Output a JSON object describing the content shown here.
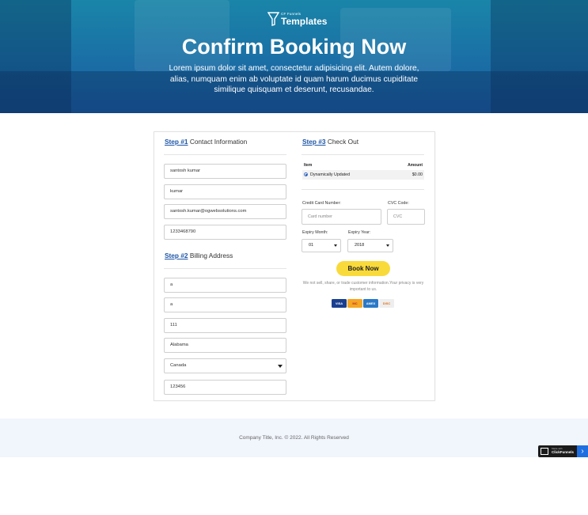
{
  "hero": {
    "logo_small": "CF Funnels",
    "logo_big": "Templates",
    "title": "Confirm Booking Now",
    "subtitle": "Lorem ipsum dolor sit amet, consectetur adipisicing elit. Autem dolore, alias, numquam enim ab voluptate id quam harum ducimus cupiditate similique quisquam et deserunt, recusandae."
  },
  "step1": {
    "link": "Step #1",
    "title": "Contact Information"
  },
  "contact_fields": [
    "santosh kumar",
    "kumar",
    "santosh.kumar@ogwebsolutions.com",
    "1233468790"
  ],
  "step2": {
    "link": "Step #2",
    "title": "Billing Address"
  },
  "billing_fields": {
    "address": "a",
    "address2": "a",
    "zip_city": "111",
    "state": "Alabama",
    "country": "Canada",
    "postal": "123456"
  },
  "step3": {
    "link": "Step #3",
    "title": "Check Out"
  },
  "order": {
    "col_item": "Item",
    "col_amount": "Amount",
    "row_item": "Dynamically Updated",
    "row_amount": "$0.00"
  },
  "payment": {
    "cc_label": "Credit Card Number:",
    "cc_placeholder": "Card number",
    "cvc_label": "CVC Code:",
    "cvc_placeholder": "CVC",
    "month_label": "Expiry Month:",
    "month_value": "01",
    "year_label": "Expiry Year:",
    "year_value": "2018",
    "book_button": "Book Now",
    "privacy": "We not sell, share, or trade customer information.Your privacy is very important to us."
  },
  "card_logos": [
    "VISA",
    "MC",
    "AMEX",
    "DISC"
  ],
  "colors": {
    "accent": "#1d55a6",
    "button": "#f9da3b",
    "hero_top": "#1a85a8",
    "hero_bottom": "#1b5aa2"
  },
  "footer": {
    "text": "Company Title, Inc. © 2022. All Rights Reserved"
  },
  "badge": {
    "line1": "Made with",
    "line2": "ClickFunnels",
    "arrow": "›"
  }
}
